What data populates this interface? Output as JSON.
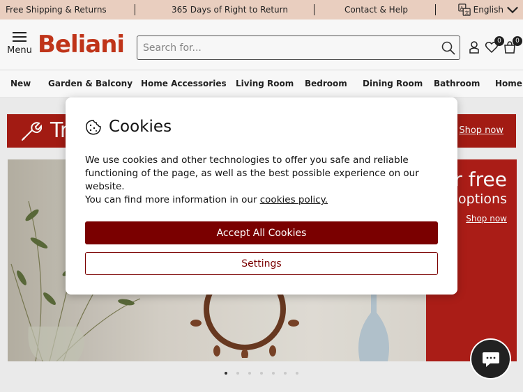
{
  "topbar": {
    "shipping": "Free Shipping & Returns",
    "return_days": "365 Days of Right to Return",
    "contact": "Contact & Help",
    "language": "English"
  },
  "header": {
    "menu_label": "Menu",
    "logo_text": "Beliani",
    "search_placeholder": "Search for...",
    "wishlist_count": "0",
    "cart_count": "0"
  },
  "nav": {
    "items": [
      "New",
      "Garden & Balcony",
      "Home Accessories",
      "Living Room",
      "Bedroom",
      "Dining Room",
      "Bathroom",
      "Home O"
    ]
  },
  "promo": {
    "title": "Tr",
    "link": "Shop now"
  },
  "hero": {
    "line1": "or free",
    "line2": "options",
    "link": "Shop now"
  },
  "carousel": {
    "active_index": 0,
    "count": 7
  },
  "cookie_modal": {
    "title": "Cookies",
    "body_line1": "We use cookies and other technologies to offer you safe and reliable functioning of the page, as well as the best possible experience on our website.",
    "body_line2_prefix": "You can find more information in our ",
    "policy_link": "cookies policy.",
    "accept_label": "Accept All Cookies",
    "settings_label": "Settings"
  },
  "colors": {
    "brand": "#c6361a",
    "accent_dark_red": "#7a0000",
    "promo_red": "#a81c14",
    "topbar_bg": "#f1d5c6"
  },
  "icons": [
    "menu-icon",
    "search-icon",
    "user-icon",
    "heart-icon",
    "cart-icon",
    "translate-icon",
    "chevron-down-icon",
    "wrench-icon",
    "cookie-icon",
    "chat-icon"
  ]
}
